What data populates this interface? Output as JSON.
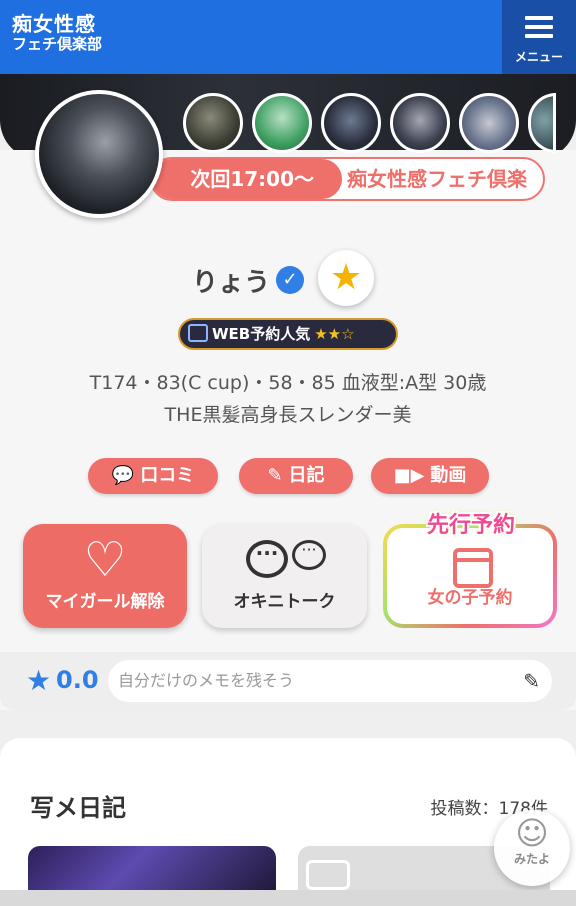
{
  "header": {
    "logo_line1": "痴女性感",
    "logo_line2": "フェチ倶楽部",
    "menu_label": "メニュー"
  },
  "profile": {
    "next_time": "次回17:00～",
    "shop_name": "痴女性感フェチ倶楽",
    "name": "りょう",
    "web_badge": "WEB予約人気",
    "web_rating_stars": 2,
    "web_rating_max": 3,
    "spec_line1": "T174・83(C cup)・58・85 血液型:A型 30歳",
    "spec_line2": "THE黒髪高身長スレンダー美"
  },
  "links": {
    "kuchikomi": "口コミ",
    "diary": "日記",
    "video": "動画"
  },
  "actions": {
    "mygirl": "マイガール解除",
    "talk": "オキニトーク",
    "reserve": "女の子予約",
    "reserve_badge": "先行予約"
  },
  "rating": {
    "score": "0.0",
    "memo_placeholder": "自分だけのメモを残そう"
  },
  "diary_section": {
    "title": "写メ日記",
    "post_count": "投稿数：178件"
  },
  "mitayo": {
    "label": "みたよ"
  },
  "colors": {
    "header_blue": "#1f6fe0",
    "accent_red": "#ef6f6b",
    "star_yellow": "#f5b400",
    "rating_blue": "#2f7fe6"
  }
}
